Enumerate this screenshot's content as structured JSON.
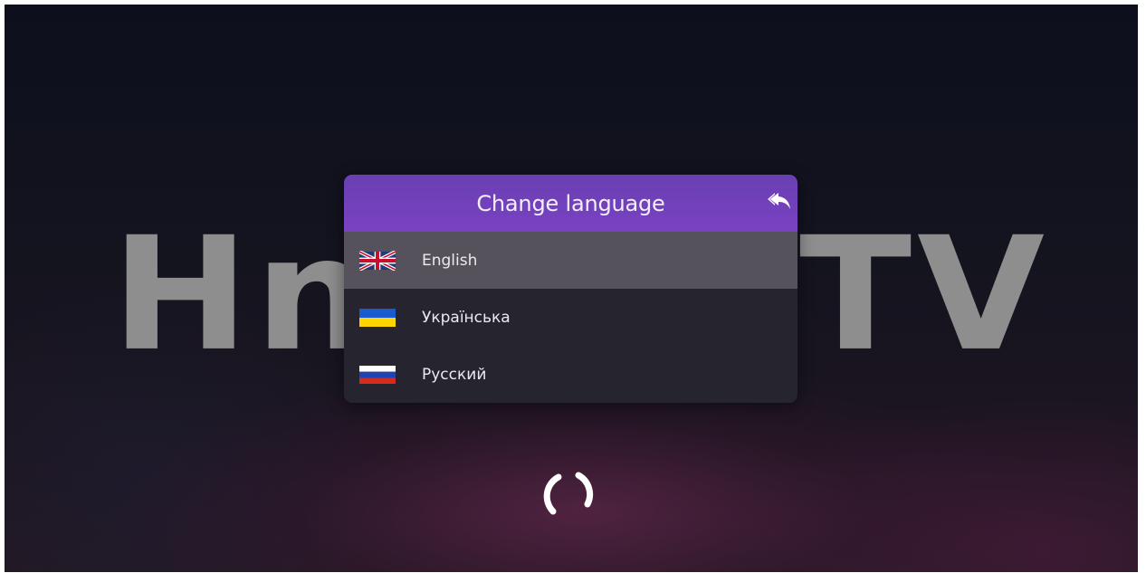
{
  "background": {
    "logo_left": "Hn",
    "logo_right": "TV"
  },
  "dialog": {
    "title": "Change language",
    "back_icon": "reply-arrow-icon",
    "items": [
      {
        "label": "English",
        "flag": "uk-flag-icon",
        "selected": true
      },
      {
        "label": "Українська",
        "flag": "ukraine-flag-icon",
        "selected": false
      },
      {
        "label": "Русский",
        "flag": "russia-flag-icon",
        "selected": false
      }
    ]
  },
  "loading_icon": "loading-spinner-icon",
  "colors": {
    "header_accent": "#7942c2",
    "selected_row": "#55525b",
    "dialog_body": "#25242f",
    "logo_gray": "#8e8e8e"
  }
}
